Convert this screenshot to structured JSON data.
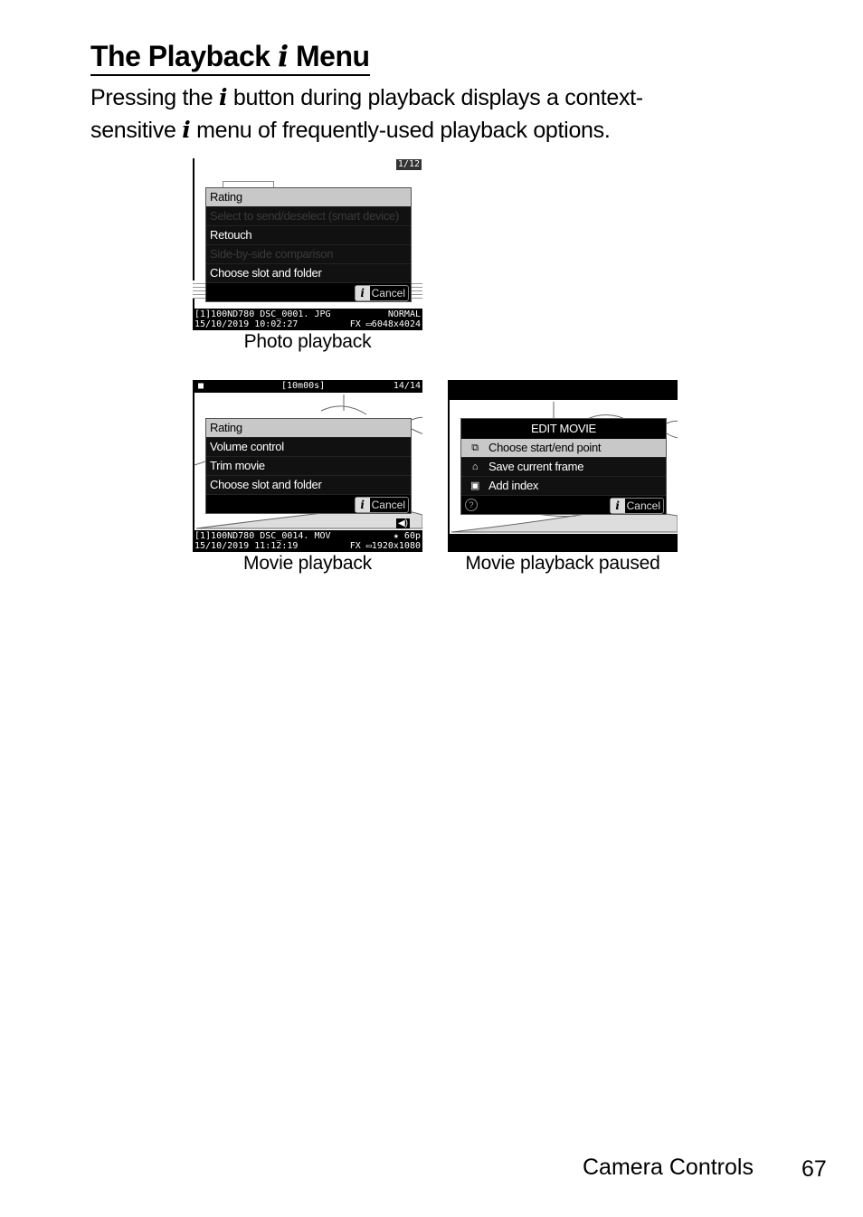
{
  "page": {
    "title_pre": "The Playback ",
    "title_i": "i",
    "title_post": " Menu",
    "intro_line1_pre": "Pressing the ",
    "intro_i": "i",
    "intro_line1_post": " button during playback displays a context-",
    "intro_line2_pre": "sensitive ",
    "intro_line2_post": " menu of frequently-used playback options.",
    "footer_section": "Camera Controls",
    "page_number": "67"
  },
  "photo_playback": {
    "counter": "1/12",
    "menu_items": [
      {
        "label": "Rating",
        "state": "selected"
      },
      {
        "label": "Select to send/deselect (smart device)",
        "state": "disabled"
      },
      {
        "label": "Retouch",
        "state": "normal"
      },
      {
        "label": "Side-by-side comparison",
        "state": "disabled"
      },
      {
        "label": "Choose slot and folder",
        "state": "normal"
      }
    ],
    "cancel_label": "Cancel",
    "cancel_icon": "i",
    "status_row1_left": "[1]100ND780 DSC_0001. JPG",
    "status_row1_right": "NORMAL",
    "status_row2_left": "15/10/2019 10:02:27",
    "status_row2_right": "FX ▭6048x4024",
    "caption": "Photo playback"
  },
  "movie_playback": {
    "movie_icon": "movie-camera-icon",
    "duration": "[10m00s]",
    "counter": "14/14",
    "menu_items": [
      {
        "label": "Rating",
        "state": "selected"
      },
      {
        "label": "Volume control",
        "state": "normal"
      },
      {
        "label": "Trim movie",
        "state": "normal"
      },
      {
        "label": "Choose slot and folder",
        "state": "normal"
      }
    ],
    "cancel_label": "Cancel",
    "cancel_icon": "i",
    "volume_icon": "speaker-icon",
    "status_row1_left": "[1]100ND780 DSC_0014. MOV",
    "status_row1_right": "★ 60p",
    "status_row2_left": "15/10/2019 11:12:19",
    "status_row2_right": "FX ▭1920x1080",
    "caption": "Movie playback"
  },
  "movie_paused": {
    "menu_title": "EDIT MOVIE",
    "menu_items": [
      {
        "label": "Choose start/end point",
        "icon": "trim-icon",
        "glyph": "⧉",
        "state": "selected"
      },
      {
        "label": "Save current frame",
        "icon": "save-frame-icon",
        "glyph": "⌂",
        "state": "normal"
      },
      {
        "label": "Add index",
        "icon": "index-icon",
        "glyph": "▣",
        "state": "normal"
      }
    ],
    "help_glyph": "?",
    "cancel_label": "Cancel",
    "cancel_icon": "i",
    "caption": "Movie playback paused"
  }
}
